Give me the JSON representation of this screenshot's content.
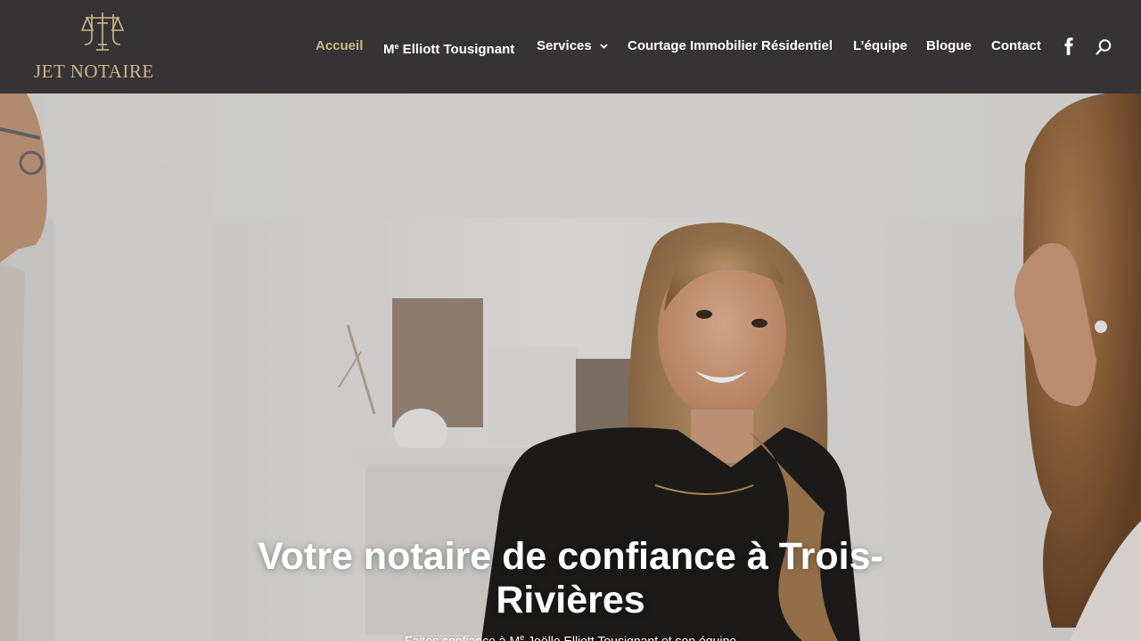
{
  "brand": {
    "name": "JET NOTAIRE",
    "logo_icon": "scales-monogram-icon",
    "accent_color": "#c9b98b",
    "header_bg": "#353334"
  },
  "nav": {
    "items": [
      {
        "label": "Accueil",
        "active": true
      },
      {
        "label_prefix": "M",
        "label_sup": "e",
        "label_rest": " Elliott Tousignant",
        "active": false
      },
      {
        "label": "Services",
        "has_dropdown": true,
        "active": false
      },
      {
        "label": "Courtage Immobilier Résidentiel",
        "active": false
      },
      {
        "label": "L’équipe",
        "active": false
      },
      {
        "label": "Blogue",
        "active": false
      },
      {
        "label": "Contact",
        "active": false
      }
    ],
    "social_icon": "facebook-icon",
    "search_icon": "search-icon"
  },
  "hero": {
    "title": "Votre notaire de confiance à Trois-Rivières",
    "subtitle_prefix": "Faites confiance à M",
    "subtitle_sup": "e",
    "subtitle_rest": " Joëlle Elliott Tousignant et son équipe"
  }
}
